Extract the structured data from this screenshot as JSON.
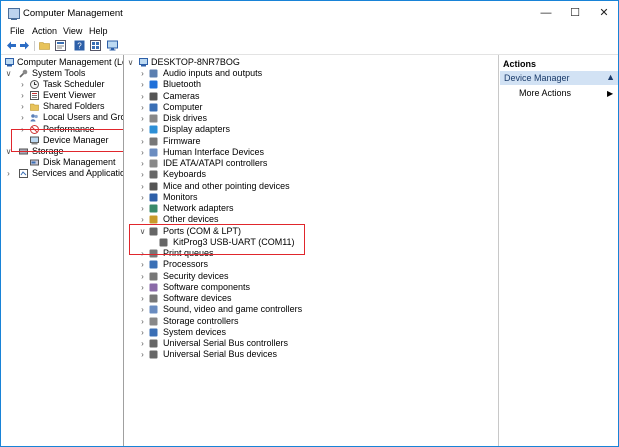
{
  "window": {
    "title": "Computer Management",
    "minimize": "—",
    "maximize": "☐",
    "close": "✕"
  },
  "menu": [
    "File",
    "Action",
    "View",
    "Help"
  ],
  "left_tree": {
    "root": "Computer Management (Local",
    "system_tools": "System Tools",
    "task_scheduler": "Task Scheduler",
    "event_viewer": "Event Viewer",
    "shared_folders": "Shared Folders",
    "local_users": "Local Users and Groups",
    "performance": "Performance",
    "device_manager": "Device Manager",
    "storage": "Storage",
    "disk_management": "Disk Management",
    "services": "Services and Applications"
  },
  "device_tree": {
    "root": "DESKTOP-8NR7BOG",
    "categories": [
      "Audio inputs and outputs",
      "Bluetooth",
      "Cameras",
      "Computer",
      "Disk drives",
      "Display adapters",
      "Firmware",
      "Human Interface Devices",
      "IDE ATA/ATAPI controllers",
      "Keyboards",
      "Mice and other pointing devices",
      "Monitors",
      "Network adapters",
      "Other devices",
      "Ports (COM & LPT)",
      "KitProg3 USB-UART (COM11)",
      "Print queues",
      "Processors",
      "Security devices",
      "Software components",
      "Software devices",
      "Sound, video and game controllers",
      "Storage controllers",
      "System devices",
      "Universal Serial Bus controllers",
      "Universal Serial Bus devices"
    ]
  },
  "actions": {
    "header": "Actions",
    "section": "Device Manager",
    "more_actions": "More Actions"
  },
  "colors": {
    "accent": "#1883d7",
    "highlight": "#e0262c",
    "selection": "#d2e2f4"
  }
}
